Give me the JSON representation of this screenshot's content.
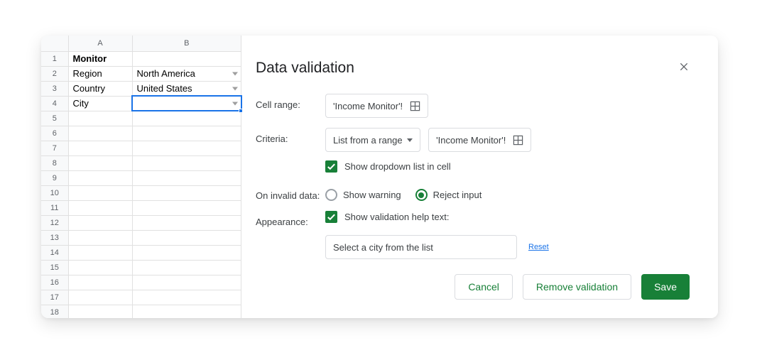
{
  "sheet": {
    "columns": [
      "A",
      "B"
    ],
    "row_count": 18,
    "cells": {
      "A1": "Monitor",
      "A2": "Region",
      "A3": "Country",
      "A4": "City",
      "B2": "North America",
      "B3": "United States"
    },
    "dropdown_cells": [
      "B2",
      "B3",
      "B4"
    ],
    "bold_cells": [
      "A1"
    ],
    "selected_cell": "B4"
  },
  "dialog": {
    "title": "Data validation",
    "labels": {
      "cell_range": "Cell range:",
      "criteria": "Criteria:",
      "on_invalid": "On invalid data:",
      "appearance": "Appearance:"
    },
    "cell_range_value": "'Income Monitor'!",
    "criteria_type": "List from a range",
    "criteria_range_value": "'Income Monitor'!",
    "show_dropdown": {
      "checked": true,
      "label": "Show dropdown list in cell"
    },
    "on_invalid_options": {
      "show_warning": "Show warning",
      "reject_input": "Reject input",
      "selected": "reject_input"
    },
    "show_help_text": {
      "checked": true,
      "label": "Show validation help text:"
    },
    "help_text_value": "Select a city from the list",
    "reset_label": "Reset",
    "buttons": {
      "cancel": "Cancel",
      "remove": "Remove validation",
      "save": "Save"
    }
  },
  "colors": {
    "accent_green": "#188038",
    "accent_blue": "#1a73e8"
  }
}
